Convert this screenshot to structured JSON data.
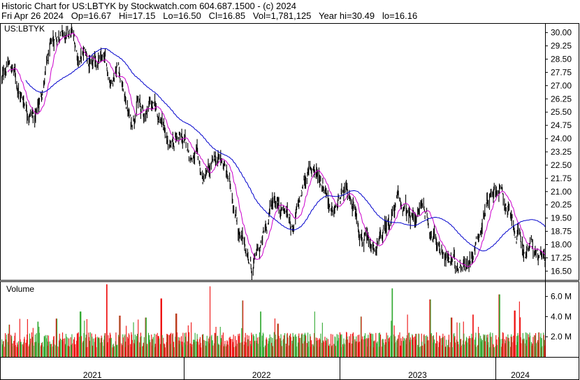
{
  "header": {
    "line1": "Historic Chart for US:LBTYK by Stockwatch.com 604.687.1500 - (c) 2024",
    "line2": "Fri Apr 26 2024   Op=16.67   Hi=17.15   Lo=16.50   Cl=16.85   Vol=1,781,125   Year hi=30.49   lo=16.16"
  },
  "colors": {
    "price": "#000000",
    "ma_short": "#cc00cc",
    "ma_long": "#0000cc",
    "volume_up": "#33aa33",
    "volume_down": "#ee1111",
    "frame": "#000000"
  },
  "chart_data": [
    {
      "type": "line",
      "title": "US:LBTYK",
      "ylim": [
        16.0,
        30.5
      ],
      "y_ticks": [
        "30.00",
        "29.25",
        "28.50",
        "27.75",
        "27.00",
        "26.25",
        "25.50",
        "24.75",
        "24.00",
        "23.25",
        "22.50",
        "21.75",
        "21.00",
        "20.25",
        "19.50",
        "18.75",
        "18.00",
        "17.25",
        "16.50"
      ],
      "x_period": [
        "2020-11-01",
        "2024-04-26"
      ],
      "x_labels": [
        "2021",
        "2022",
        "2023",
        "2024"
      ],
      "grid": false,
      "price_anchors": [
        [
          "2020-11-01",
          27.2
        ],
        [
          "2020-11-15",
          28.3
        ],
        [
          "2020-12-01",
          27.8
        ],
        [
          "2020-12-15",
          26.5
        ],
        [
          "2021-01-01",
          25.8
        ],
        [
          "2021-01-20",
          25.2
        ],
        [
          "2021-02-05",
          26.8
        ],
        [
          "2021-02-20",
          28.6
        ],
        [
          "2021-03-05",
          29.6
        ],
        [
          "2021-03-20",
          30.2
        ],
        [
          "2021-04-01",
          29.5
        ],
        [
          "2021-04-15",
          29.9
        ],
        [
          "2021-05-01",
          28.5
        ],
        [
          "2021-05-15",
          28.8
        ],
        [
          "2021-06-01",
          27.8
        ],
        [
          "2021-06-15",
          28.4
        ],
        [
          "2021-07-01",
          28.2
        ],
        [
          "2021-07-15",
          27.3
        ],
        [
          "2021-08-01",
          28.4
        ],
        [
          "2021-08-15",
          26.5
        ],
        [
          "2021-09-01",
          24.8
        ],
        [
          "2021-09-15",
          26.2
        ],
        [
          "2021-10-01",
          25.2
        ],
        [
          "2021-10-15",
          26.2
        ],
        [
          "2021-11-01",
          25.5
        ],
        [
          "2021-11-15",
          24.8
        ],
        [
          "2021-12-01",
          23.2
        ],
        [
          "2021-12-15",
          24.2
        ],
        [
          "2022-01-01",
          23.8
        ],
        [
          "2022-01-15",
          23.2
        ],
        [
          "2022-02-01",
          22.8
        ],
        [
          "2022-02-15",
          21.6
        ],
        [
          "2022-03-01",
          22.0
        ],
        [
          "2022-03-15",
          22.6
        ],
        [
          "2022-04-01",
          22.8
        ],
        [
          "2022-04-15",
          21.8
        ],
        [
          "2022-05-01",
          20.2
        ],
        [
          "2022-05-15",
          18.3
        ],
        [
          "2022-06-01",
          17.4
        ],
        [
          "2022-06-10",
          16.6
        ],
        [
          "2022-06-20",
          17.3
        ],
        [
          "2022-07-01",
          17.8
        ],
        [
          "2022-07-15",
          19.2
        ],
        [
          "2022-08-01",
          20.8
        ],
        [
          "2022-08-15",
          20.3
        ],
        [
          "2022-09-01",
          19.8
        ],
        [
          "2022-09-15",
          19.0
        ],
        [
          "2022-10-01",
          20.4
        ],
        [
          "2022-10-15",
          22.0
        ],
        [
          "2022-11-01",
          22.4
        ],
        [
          "2022-11-15",
          21.8
        ],
        [
          "2022-12-01",
          21.3
        ],
        [
          "2022-12-15",
          19.6
        ],
        [
          "2023-01-01",
          20.4
        ],
        [
          "2023-01-15",
          20.8
        ],
        [
          "2023-02-01",
          20.5
        ],
        [
          "2023-02-15",
          19.2
        ],
        [
          "2023-03-01",
          18.3
        ],
        [
          "2023-03-15",
          17.5
        ],
        [
          "2023-04-01",
          17.8
        ],
        [
          "2023-04-15",
          18.6
        ],
        [
          "2023-05-01",
          19.6
        ],
        [
          "2023-05-15",
          20.4
        ],
        [
          "2023-06-01",
          20.0
        ],
        [
          "2023-06-15",
          19.4
        ],
        [
          "2023-07-01",
          19.6
        ],
        [
          "2023-07-15",
          20.4
        ],
        [
          "2023-08-01",
          19.0
        ],
        [
          "2023-08-15",
          18.2
        ],
        [
          "2023-09-01",
          17.7
        ],
        [
          "2023-09-15",
          17.0
        ],
        [
          "2023-10-01",
          16.9
        ],
        [
          "2023-10-15",
          17.2
        ],
        [
          "2023-11-01",
          16.9
        ],
        [
          "2023-11-15",
          18.3
        ],
        [
          "2023-12-01",
          19.2
        ],
        [
          "2023-12-15",
          20.8
        ],
        [
          "2024-01-01",
          21.4
        ],
        [
          "2024-01-10",
          21.2
        ],
        [
          "2024-01-25",
          20.3
        ],
        [
          "2024-02-10",
          19.0
        ],
        [
          "2024-02-25",
          18.3
        ],
        [
          "2024-03-10",
          17.6
        ],
        [
          "2024-03-25",
          17.9
        ],
        [
          "2024-04-10",
          17.3
        ],
        [
          "2024-04-26",
          16.85
        ]
      ],
      "series": [
        {
          "name": "",
          "role": "price",
          "style": "daily high-low bars"
        },
        {
          "name": "",
          "role": "short moving average"
        },
        {
          "name": "",
          "role": "long moving average"
        }
      ]
    },
    {
      "type": "bar",
      "title": "Volume",
      "ylim": [
        0,
        7500000
      ],
      "y_ticks": [
        "6.0 M",
        "4.0 M",
        "2.0 M"
      ],
      "y_tick_values": [
        6000000,
        4000000,
        2000000
      ],
      "typical_volume": 1700000,
      "spikes": [
        [
          "2020-11-20",
          3.2
        ],
        [
          "2021-01-25",
          3.5
        ],
        [
          "2021-03-10",
          3.8
        ],
        [
          "2021-05-05",
          4.5
        ],
        [
          "2021-07-05",
          7.2
        ],
        [
          "2021-08-05",
          4.1
        ],
        [
          "2021-10-05",
          3.9
        ],
        [
          "2021-11-10",
          5.8
        ],
        [
          "2021-12-15",
          4.3
        ],
        [
          "2022-03-05",
          7.0
        ],
        [
          "2022-05-20",
          5.6
        ],
        [
          "2022-07-01",
          4.5
        ],
        [
          "2022-08-10",
          3.3
        ],
        [
          "2022-11-05",
          4.5
        ],
        [
          "2023-02-20",
          4.0
        ],
        [
          "2023-05-05",
          6.8
        ],
        [
          "2023-06-10",
          4.2
        ],
        [
          "2023-08-01",
          5.7
        ],
        [
          "2023-09-20",
          3.9
        ],
        [
          "2023-11-10",
          4.2
        ],
        [
          "2024-01-10",
          6.2
        ],
        [
          "2024-02-15",
          4.6
        ],
        [
          "2024-02-25",
          5.5
        ]
      ]
    }
  ]
}
